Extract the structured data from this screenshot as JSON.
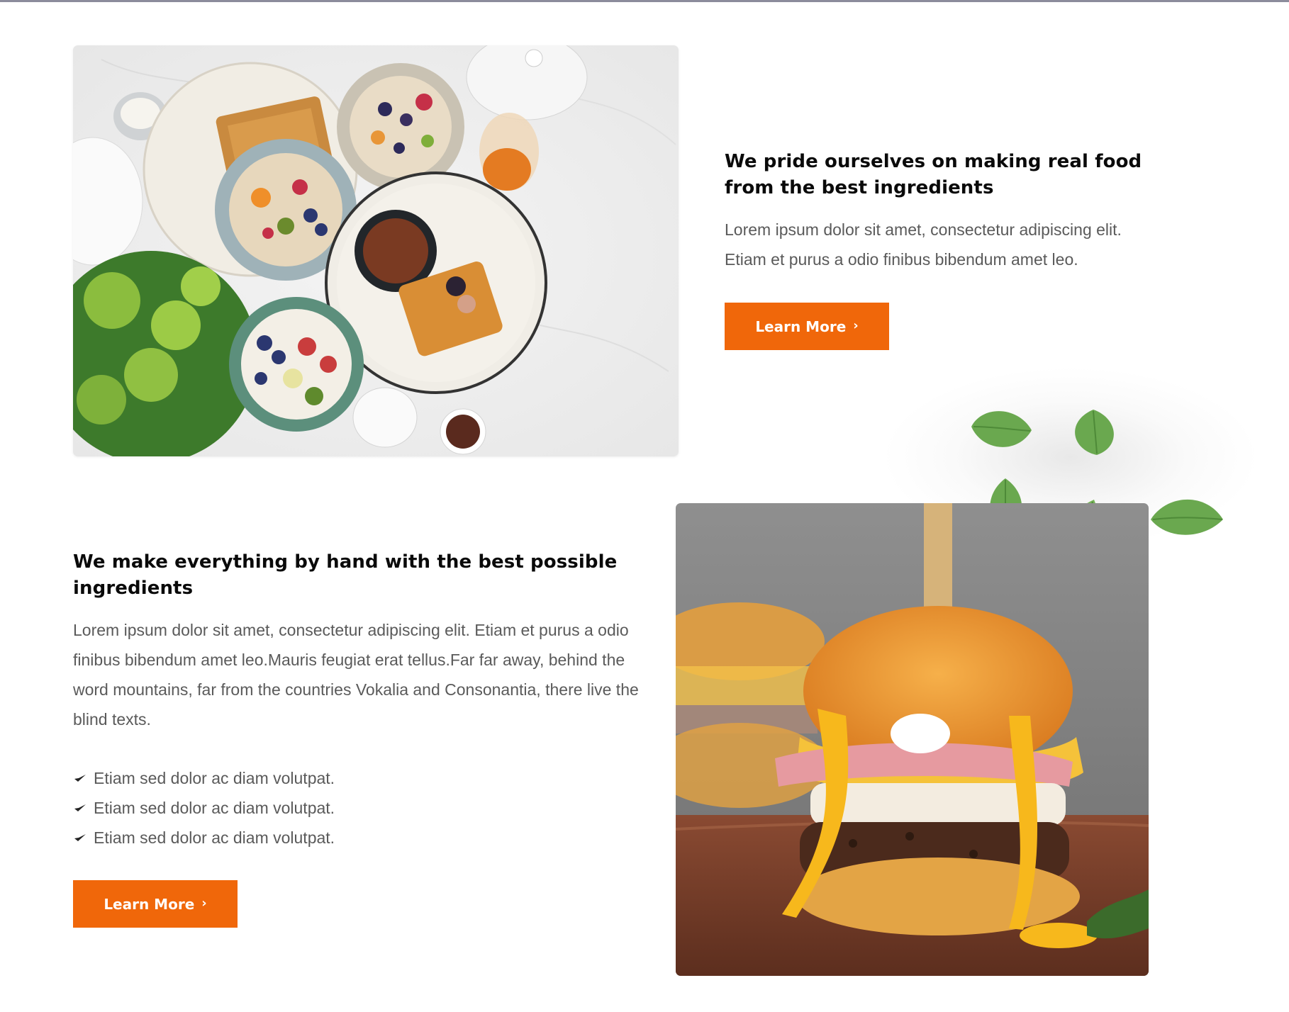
{
  "section_one": {
    "heading": "We pride ourselves on making real food from the best ingredients",
    "paragraph": "Lorem ipsum dolor sit amet, consectetur adipiscing elit. Etiam et purus a odio finibus bibendum amet leo.",
    "button_label": "Learn More",
    "button_icon": "chevron-right-icon"
  },
  "section_two": {
    "heading": "We make everything by hand with the best possible ingredients",
    "paragraph": "Lorem ipsum dolor sit amet, consectetur adipiscing elit. Etiam et purus a odio finibus bibendum amet leo.Mauris feugiat erat tellus.Far far away, behind the word mountains, far from the countries Vokalia and Consonantia, there live the blind texts.",
    "checklist": [
      "Etiam sed dolor ac diam volutpat.",
      "Etiam sed dolor ac diam volutpat.",
      "Etiam sed dolor ac diam volutpat."
    ],
    "button_label": "Learn More",
    "button_icon": "chevron-right-icon"
  },
  "colors": {
    "accent": "#f0670a",
    "heading": "#0a0a0a",
    "body_text": "#5a5a5a",
    "leaf_green": "#6aa84f"
  }
}
